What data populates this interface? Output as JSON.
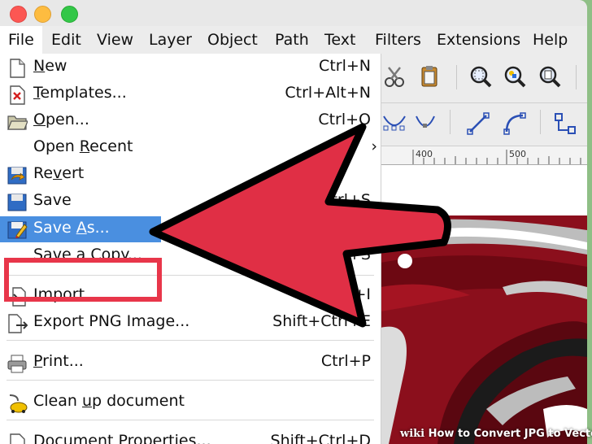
{
  "menubar": {
    "items": [
      "File",
      "Edit",
      "View",
      "Layer",
      "Object",
      "Path",
      "Text",
      "Filters",
      "Extensions",
      "Help"
    ]
  },
  "file_menu": {
    "new": {
      "label": "New",
      "underline": "N",
      "shortcut": "Ctrl+N"
    },
    "templates": {
      "label": "Templates...",
      "underline": "T",
      "shortcut": "Ctrl+Alt+N"
    },
    "open": {
      "label": "Open...",
      "underline": "O",
      "shortcut": "Ctrl+O"
    },
    "open_recent": {
      "label": "Open Recent",
      "underline": "R"
    },
    "revert": {
      "label": "Revert",
      "underline": "v"
    },
    "save": {
      "label": "Save",
      "shortcut": "Ctrl+S"
    },
    "save_as": {
      "label": "Save As...",
      "underline": "A"
    },
    "save_copy": {
      "label": "Save a Copy...",
      "shortcut": "Shift+Ctrl+Alt+S"
    },
    "import": {
      "label": "Import...",
      "underline": "I",
      "shortcut": "Ctrl+I"
    },
    "export_png": {
      "label": "Export PNG Image...",
      "shortcut": "Shift+Ctrl+E"
    },
    "print": {
      "label": "Print...",
      "underline": "P",
      "shortcut": "Ctrl+P"
    },
    "clean_up": {
      "label": "Clean up document",
      "underline": "u"
    },
    "doc_props": {
      "label": "Document Properties...",
      "shortcut": "Shift+Ctrl+D"
    }
  },
  "ruler": {
    "labels": [
      "400",
      "500"
    ]
  },
  "watermark": {
    "brand": "wiki",
    "text": "How to Convert JPG to Vector"
  },
  "colors": {
    "accent": "#e8364a",
    "selection": "#4a8fe0",
    "car_red": "#8b0f1c"
  },
  "icons": [
    "scissors-icon",
    "paste-icon",
    "zoom-selection-icon",
    "zoom-drawing-icon",
    "zoom-page-icon",
    "node-smooth-icon",
    "node-symmetric-icon",
    "segment-line-icon",
    "segment-curve-icon",
    "object-to-path-icon"
  ]
}
